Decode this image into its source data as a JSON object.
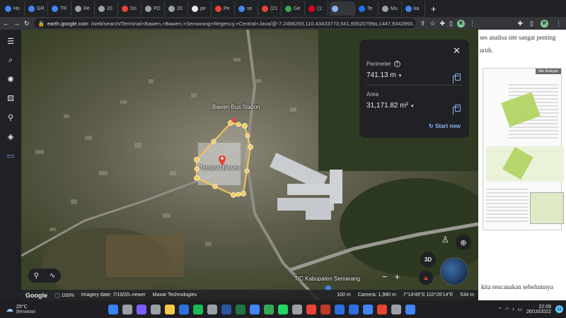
{
  "browser": {
    "tabs": [
      {
        "label": "Ho",
        "color": "#4285f4"
      },
      {
        "label": "GR",
        "color": "#4285f4"
      },
      {
        "label": "TR",
        "color": "#4285f4"
      },
      {
        "label": "Re",
        "color": "#9aa0a6"
      },
      {
        "label": "20",
        "color": "#9aa0a6"
      },
      {
        "label": "Do",
        "color": "#ea4335"
      },
      {
        "label": "PD",
        "color": "#9aa0a6"
      },
      {
        "label": "20",
        "color": "#9aa0a6"
      },
      {
        "label": "pe",
        "color": "#e8eaed"
      },
      {
        "label": "Pe",
        "color": "#ea4335"
      },
      {
        "label": "se",
        "color": "#4285f4"
      },
      {
        "label": "(21",
        "color": "#ea4335"
      },
      {
        "label": "Ge",
        "color": "#34a853"
      },
      {
        "label": "(1:",
        "color": "#e60023"
      },
      {
        "label": "",
        "color": "#8ab4f8"
      },
      {
        "label": "Te",
        "color": "#1a73e8"
      },
      {
        "label": "Mu",
        "color": "#9aa0a6"
      },
      {
        "label": "ka",
        "color": "#4285f4"
      }
    ],
    "new_tab": "+",
    "url_host": "earth.google.com",
    "url_path": "/web/search/Terminal+Bawen,+Bawen,+Semarang+Regency,+Central+Java/@-7.2456293,110.43433773,541.90520799a,1447.9342993..."
  },
  "map": {
    "labels": {
      "bus_station": "Bawen Bus Station",
      "terminal": "Terminal Bawen",
      "tic": "TIC Kabupaten Semarang"
    },
    "measure_panel": {
      "perimeter_label": "Perimeter",
      "perimeter_value": "741.13 m",
      "area_label": "Area",
      "area_value": "31,171.82 m²",
      "start_new": "Start new"
    },
    "controls": {
      "three_d": "3D"
    },
    "status": {
      "brand": "Google",
      "zoom": "100%",
      "imagery_date": "Imagery date: 7/19/20–newer",
      "provider": "Maxar Technologies",
      "scale": "100 m",
      "camera": "Camera: 1,990 m",
      "coords": "7°14'49\"S 110°26'14\"E",
      "elevation": "534 m"
    }
  },
  "doc": {
    "line1": "ses analisa site sangat penting",
    "line2": "uruh.",
    "heading": "Site Analysis",
    "bottom": "kita rencanakan sebelumnya"
  },
  "taskbar": {
    "temp": "25°C",
    "weather": "Berawan",
    "time": "22:09",
    "date": "26/10/2022",
    "badge": "11"
  }
}
